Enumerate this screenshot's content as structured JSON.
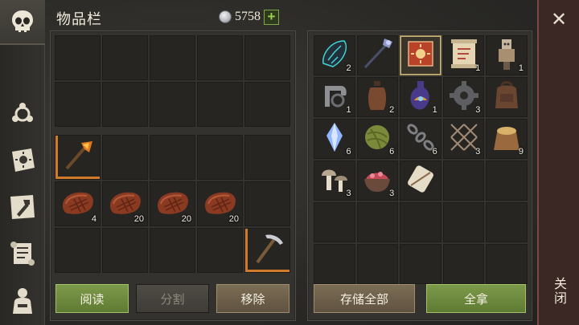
{
  "header": {
    "title": "物品栏",
    "currency_value": "5758",
    "plus_label": "+"
  },
  "left_panel": {
    "items": [
      {
        "row": 2,
        "col": 0,
        "icon": "flaming-torch-icon",
        "count": ""
      },
      {
        "row": 3,
        "col": 0,
        "icon": "raw-meat-icon",
        "count": "4"
      },
      {
        "row": 3,
        "col": 1,
        "icon": "raw-meat-icon",
        "count": "20"
      },
      {
        "row": 3,
        "col": 2,
        "icon": "raw-meat-icon",
        "count": "20"
      },
      {
        "row": 3,
        "col": 3,
        "icon": "raw-meat-icon",
        "count": "20"
      },
      {
        "row": 4,
        "col": 4,
        "icon": "pickaxe-icon",
        "count": ""
      }
    ]
  },
  "right_panel": {
    "items": [
      {
        "row": 0,
        "col": 0,
        "icon": "glowing-cocoon-icon",
        "count": "2"
      },
      {
        "row": 0,
        "col": 1,
        "icon": "magic-staff-icon",
        "count": ""
      },
      {
        "row": 0,
        "col": 2,
        "icon": "sun-tome-icon",
        "count": "",
        "selected": true
      },
      {
        "row": 0,
        "col": 3,
        "icon": "scroll-map-icon",
        "count": "1"
      },
      {
        "row": 0,
        "col": 4,
        "icon": "totem-figure-icon",
        "count": "1"
      },
      {
        "row": 1,
        "col": 0,
        "icon": "iron-clamp-icon",
        "count": "1"
      },
      {
        "row": 1,
        "col": 1,
        "icon": "leather-bottle-icon",
        "count": "2"
      },
      {
        "row": 1,
        "col": 2,
        "icon": "potion-vial-icon",
        "count": "1"
      },
      {
        "row": 1,
        "col": 3,
        "icon": "gear-mechanism-icon",
        "count": "3"
      },
      {
        "row": 1,
        "col": 4,
        "icon": "leather-backpack-icon",
        "count": ""
      },
      {
        "row": 2,
        "col": 0,
        "icon": "crystal-shard-icon",
        "count": "6"
      },
      {
        "row": 2,
        "col": 1,
        "icon": "fiber-ball-icon",
        "count": "6"
      },
      {
        "row": 2,
        "col": 2,
        "icon": "iron-chain-icon",
        "count": "6"
      },
      {
        "row": 2,
        "col": 3,
        "icon": "rope-net-icon",
        "count": "3"
      },
      {
        "row": 2,
        "col": 4,
        "icon": "grain-sack-icon",
        "count": "9"
      },
      {
        "row": 3,
        "col": 0,
        "icon": "mushrooms-icon",
        "count": "3"
      },
      {
        "row": 3,
        "col": 1,
        "icon": "meat-bowl-icon",
        "count": "3"
      },
      {
        "row": 3,
        "col": 2,
        "icon": "cloth-roll-icon",
        "count": ""
      }
    ]
  },
  "buttons": {
    "read": "阅读",
    "split": "分割",
    "remove": "移除",
    "store_all": "存储全部",
    "take_all": "全拿"
  },
  "close": {
    "x_label": "✕",
    "text": "关闭"
  }
}
